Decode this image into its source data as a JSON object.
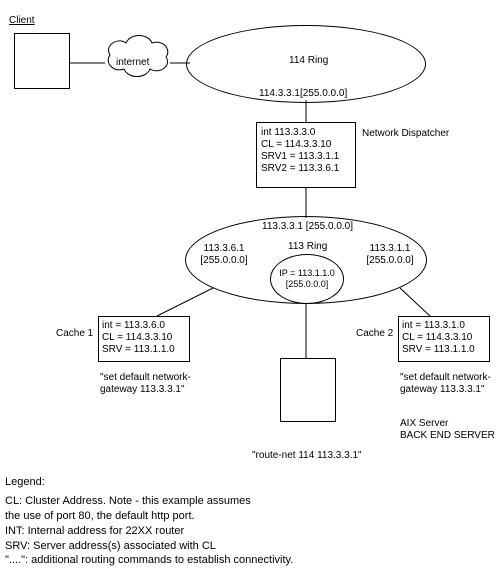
{
  "title": "Client",
  "cloud": "internet",
  "ring114": "114 Ring",
  "ring114_addr": "114.3.3.1[255.0.0.0]",
  "dispatcher_label": "Network Dispatcher",
  "dispatcher": {
    "int": "int 113.3.3.0",
    "cl": "CL = 114.3.3.10",
    "srv1": "SRV1 = 113.3.1.1",
    "srv2": "SRV2 = 113.3.6.1"
  },
  "ring113_top": "113.3.3.1 [255.0.0.0]",
  "ring113_left": "113.3.6.1 [255.0.0.0]",
  "ring113_right": "113.3.1.1 [255.0.0.0]",
  "ring113_name": "113 Ring",
  "ring113_inner": "IP = 113.1.1.0 [255.0.0.0]",
  "cache1_label": "Cache 1",
  "cache1": {
    "int": "int = 113.3.6.0",
    "cl": "CL = 114.3.3.10",
    "srv": "SRV = 113.1.1.0"
  },
  "cache1_note": "\"set default network-gateway 113.3.3.1\"",
  "cache2_label": "Cache 2",
  "cache2": {
    "int": "int = 113.3.1.0",
    "cl": "CL = 114.3.3.10",
    "srv": "SRV = 113.1.1.0"
  },
  "cache2_note": "\"set default network-gateway 113.3.3.1\"",
  "aix_label1": "AIX Server",
  "aix_label2": "BACK END SERVER",
  "aix_note": "\"route-net 114 113.3.3.1\"",
  "legend_title": "Legend:",
  "legend": {
    "cl1": "CL:   Cluster Address. Note - this example assumes",
    "cl2": "         the use of port 80, the default http port.",
    "int": "INT:  Internal address for 22XX router",
    "srv": "SRV: Server address(s) associated with CL",
    "dots": "\"....\":  additional routing commands to establish connectivity."
  }
}
